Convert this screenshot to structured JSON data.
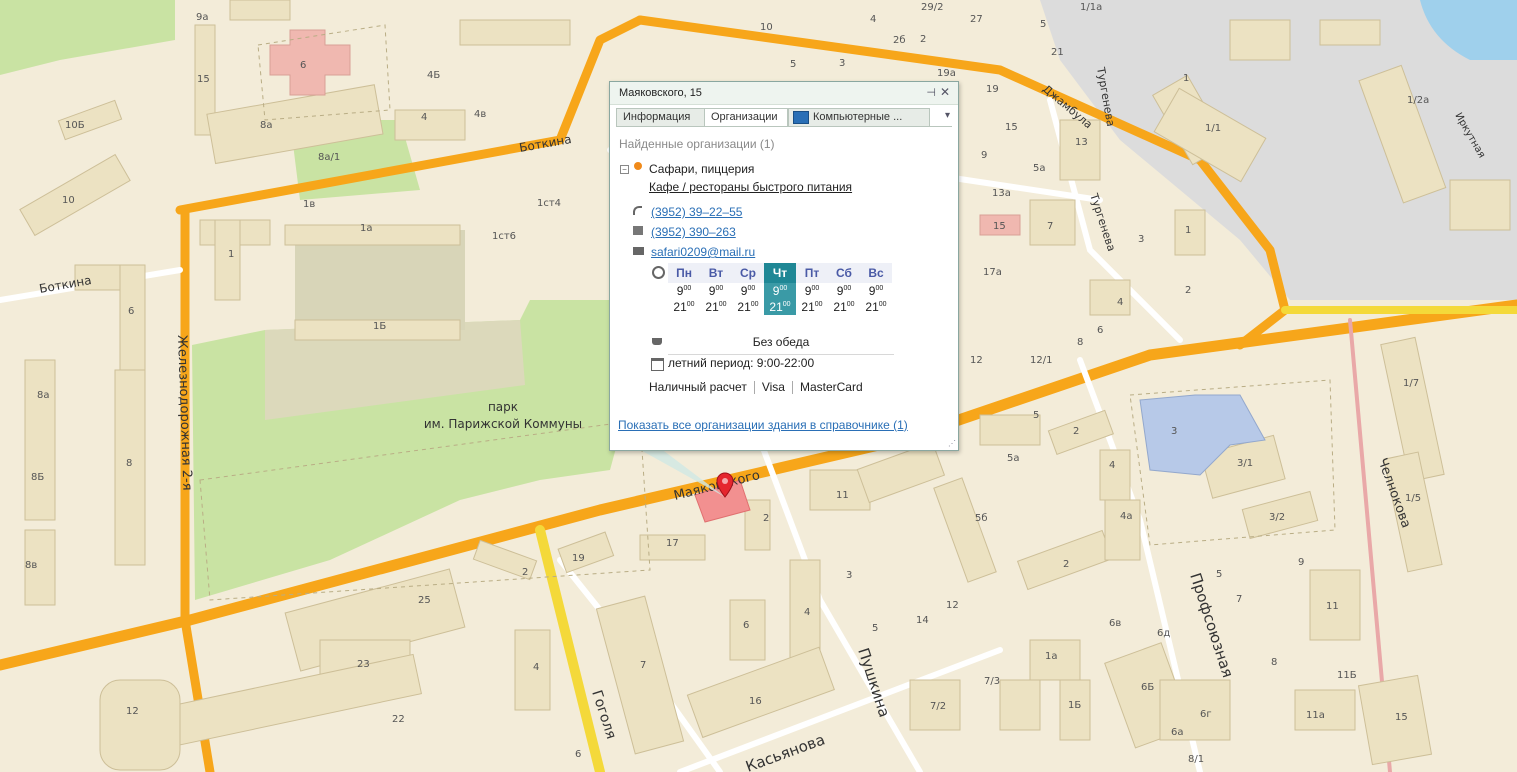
{
  "popup": {
    "title": "Маяковского, 15",
    "tabs": [
      "Информация",
      "Организации",
      "Компьютерные ..."
    ],
    "active_tab": "Организации",
    "found_label": "Найденные организации (1)",
    "org_name": "Сафари, пиццерия",
    "org_category": "Кафе / рестораны быстрого питания",
    "phone": "(3952) 39–22–55",
    "fax": "(3952) 390–263",
    "email": "safari0209@mail.ru",
    "schedule": {
      "days": [
        "Пн",
        "Вт",
        "Ср",
        "Чт",
        "Пт",
        "Сб",
        "Вс"
      ],
      "today": "Чт",
      "open_hour": "9",
      "open_min": "00",
      "close_hour": "21",
      "close_min": "00"
    },
    "lunch": "Без обеда",
    "summer_period": "летний период: 9:00-22:00",
    "payments": [
      "Наличный расчет",
      "Visa",
      "MasterCard"
    ],
    "show_all_link": "Показать все организации здания в справочнике (1)"
  },
  "map": {
    "colors": {
      "background": "#f3ecd9",
      "park": "#c9e3a3",
      "road_main": "#f7a61a",
      "road_secondary": "#f4d93a",
      "building": "#ece2c2",
      "building_highlight": "#f0a0a0"
    },
    "poi_label": "парк им. Парижской Коммуны",
    "poi_label_lines": [
      "парк",
      "им. Парижской Коммуны"
    ],
    "streets": [
      "Боткина",
      "Боткина",
      "Железнодорожная 2-я",
      "Маяковского",
      "Гоголя",
      "Касьянова",
      "Пушкина",
      "Профсоюзная",
      "Челнокова",
      "Тургенева",
      "Тургенева",
      "Джамбула",
      "Иркутная"
    ],
    "house_numbers": [
      "9а",
      "10",
      "4",
      "29/2",
      "27",
      "1/1а",
      "6",
      "4Б",
      "15",
      "10Б",
      "8а",
      "8а/1",
      "10",
      "1в",
      "1а",
      "1ст4",
      "1ст6",
      "1Б",
      "6",
      "8а",
      "8Б",
      "8",
      "8в",
      "1",
      "2",
      "25",
      "23",
      "22",
      "12",
      "19",
      "17",
      "2",
      "4",
      "6",
      "7",
      "6",
      "16",
      "5",
      "3",
      "2б",
      "2",
      "19а",
      "19",
      "15",
      "9",
      "13а",
      "5а",
      "13",
      "7",
      "3",
      "1",
      "2",
      "15",
      "17а",
      "4",
      "6",
      "8",
      "12",
      "12/1",
      "1",
      "1/2а",
      "1/1",
      "1/7",
      "3",
      "3/1",
      "3/2",
      "1/5",
      "2",
      "4",
      "4а",
      "5б",
      "5а",
      "2",
      "11",
      "3",
      "12",
      "14",
      "5",
      "6в",
      "6д",
      "1а",
      "7/3",
      "7/2",
      "1Б",
      "6Б",
      "6а",
      "6г",
      "8/1",
      "5",
      "7",
      "9",
      "11",
      "11Б",
      "11а",
      "15",
      "21",
      "4в",
      "2б"
    ],
    "marker_color": "#e5262e"
  }
}
